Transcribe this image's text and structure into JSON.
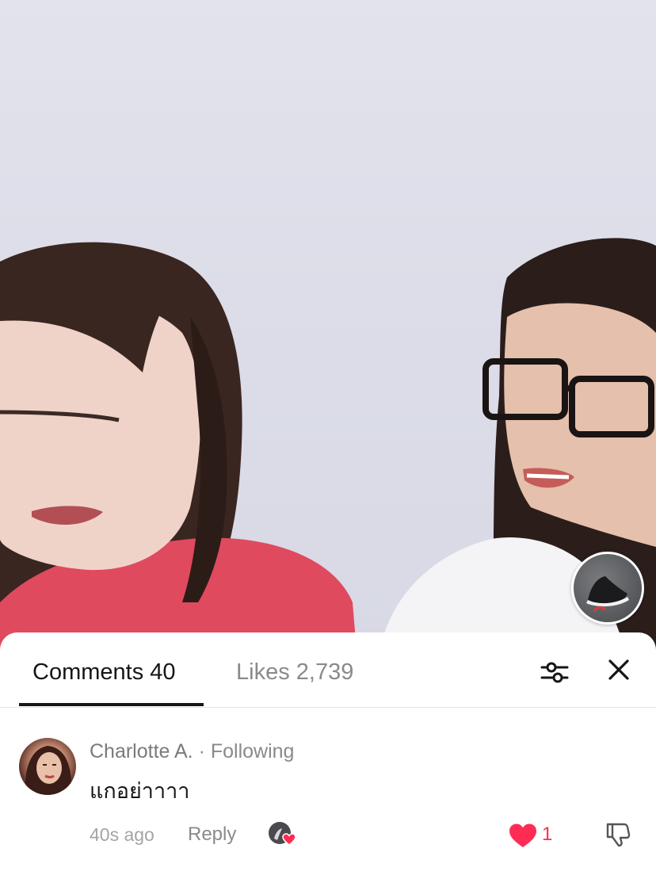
{
  "tabs": {
    "comments_label": "Comments 40",
    "likes_label": "Likes 2,739",
    "active": "comments"
  },
  "icons": {
    "filter": "sliders-icon",
    "close": "close-icon",
    "like": "heart-icon",
    "dislike": "thumbs-down-icon",
    "creator_liked": "creator-heart-icon"
  },
  "colors": {
    "accent_like": "#fe2c55",
    "text_primary": "#161616",
    "text_secondary": "#8a8a8e"
  },
  "comment": {
    "author": "Charlotte A.",
    "separator": " · ",
    "relation": "Following",
    "text": "แกอย่าาาา",
    "time_ago": "40s ago",
    "reply_label": "Reply",
    "like_count": "1",
    "liked": true
  }
}
